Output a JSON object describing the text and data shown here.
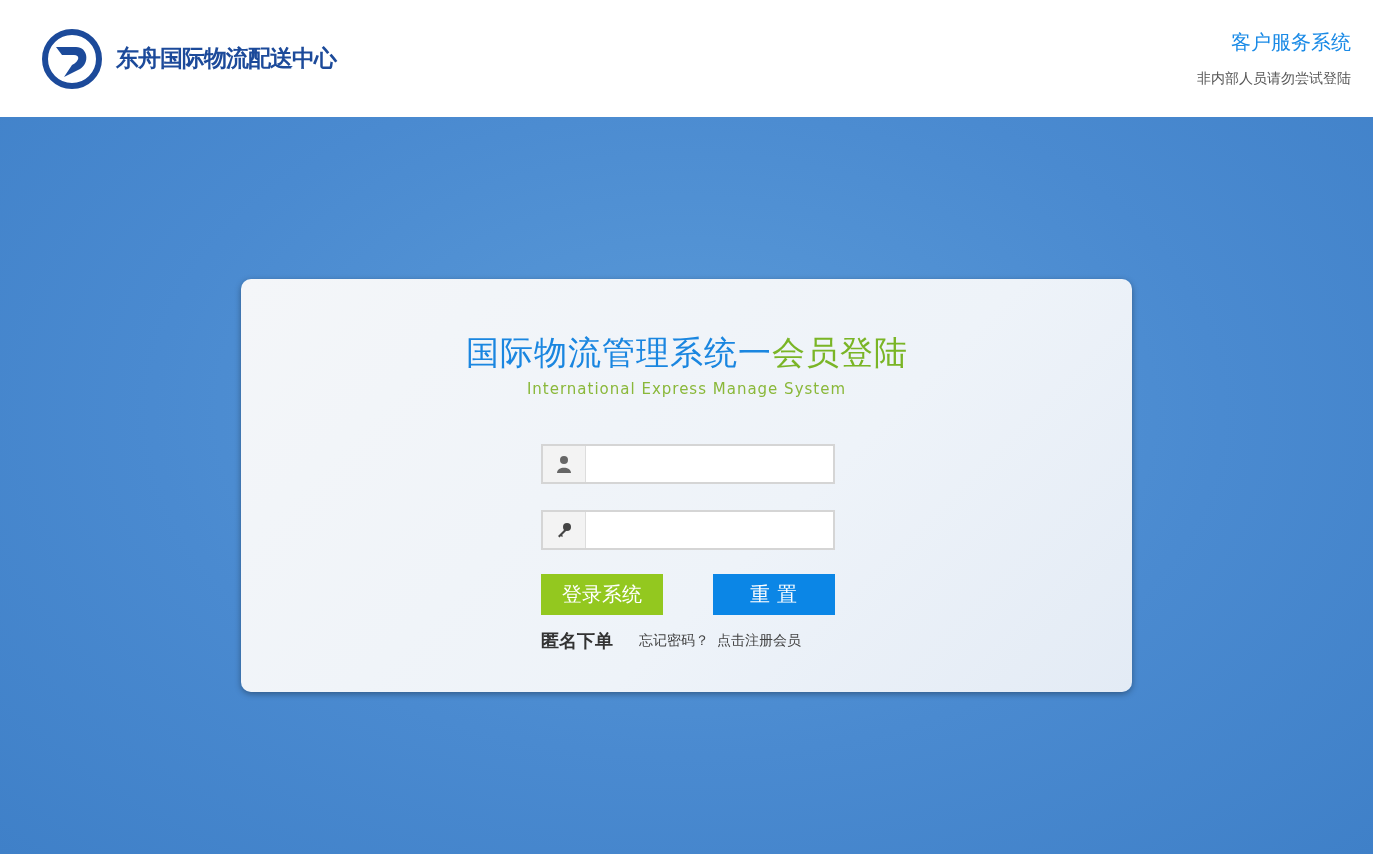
{
  "header": {
    "logo_text": "东舟国际物流配送中心",
    "system_name": "客户服务系统",
    "notice": "非内部人员请勿尝试登陆"
  },
  "login": {
    "title_main": "国际物流管理系统一",
    "title_accent": "会员登陆",
    "subtitle": "International Express Manage System",
    "fields": [
      {
        "kind": "username"
      },
      {
        "kind": "password"
      }
    ],
    "submit": "登录系统",
    "reset": "重 置",
    "anonymous": "匿名下单",
    "forgot": "忘记密码？",
    "register": "点击注册会员"
  }
}
